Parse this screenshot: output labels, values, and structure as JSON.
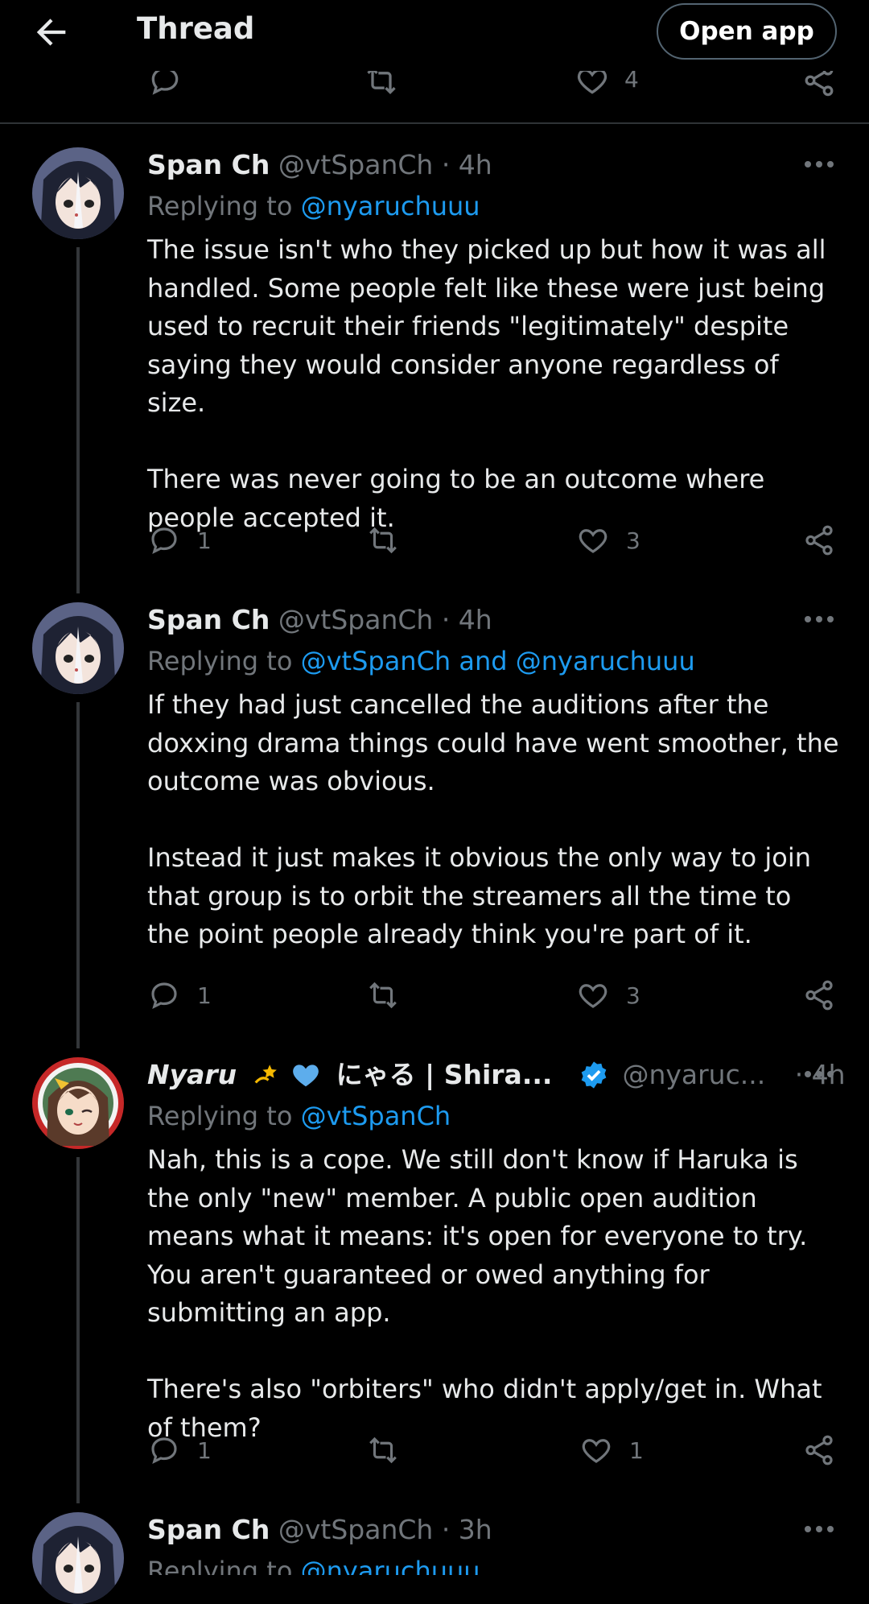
{
  "header": {
    "title": "Thread",
    "open_app": "Open app"
  },
  "prev_actions": {
    "like_count": "4"
  },
  "tweets": [
    {
      "display_name": "Span Ch",
      "handle": "@vtSpanCh",
      "time": "· 4h",
      "replying_prefix": "Replying to ",
      "replying_to": "@nyaruchuuu",
      "paragraphs": [
        "The issue isn't who they picked up but how it was all handled. Some people felt like these were just being used to recruit their friends \"legitimately\" despite saying they would consider anyone regardless of size.",
        "There was never going to be an outcome where people accepted it."
      ],
      "reply_count": "1",
      "retweet_count": "",
      "like_count": "3"
    },
    {
      "display_name": "Span Ch",
      "handle": "@vtSpanCh",
      "time": "· 4h",
      "replying_prefix": "Replying to ",
      "replying_to": "@vtSpanCh and @nyaruchuuu",
      "paragraphs": [
        "If they had just cancelled the auditions after the doxxing drama things could have went smoother, the outcome was obvious.",
        "Instead it just makes it obvious the only way to join that group is to orbit the streamers all the time to the point people already think you're part of it."
      ],
      "reply_count": "1",
      "retweet_count": "",
      "like_count": "3"
    },
    {
      "display_name_a": "Nyaru",
      "display_name_b": "にゃる | Shira...",
      "handle": "@nyaruc...",
      "time": "· 4h",
      "verified": true,
      "replying_prefix": "Replying to ",
      "replying_to": "@vtSpanCh",
      "paragraphs": [
        "Nah, this is a cope. We still don't know if Haruka is the only \"new\" member. A public open audition means what it means: it's open for everyone to try. You aren't guaranteed or owed anything for submitting an app.",
        "There's also \"orbiters\" who didn't apply/get in. What of them?"
      ],
      "reply_count": "1",
      "retweet_count": "",
      "like_count": "1"
    },
    {
      "display_name": "Span Ch",
      "handle": "@vtSpanCh",
      "time": "· 3h",
      "replying_prefix": "Replying to ",
      "replying_to": "@nyaruchuuu"
    }
  ],
  "colors": {
    "background": "#000000",
    "text": "#e7e9ea",
    "muted": "#71767b",
    "link": "#1d9bf0",
    "verified": "#1d9bf0",
    "divider": "#2f3336"
  }
}
